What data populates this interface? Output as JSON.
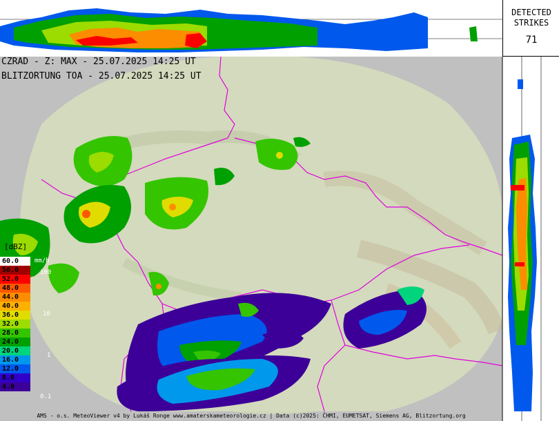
{
  "header": {
    "radar_line": "CZRAD - Z: MAX - 25.07.2025 14:25 UT",
    "lightning_line": "BLITZORTUNG TOA - 25.07.2025 14:25 UT"
  },
  "strikes": {
    "label_line1": "DETECTED",
    "label_line2": "STRIKES",
    "count": "71"
  },
  "legend": {
    "title": "[dBZ]",
    "unit": "mm/h",
    "entries": [
      {
        "label": "60.0",
        "color": "#ffffff",
        "text_color": "#000000"
      },
      {
        "label": "56.0",
        "color": "#a00000",
        "text_color": "#000000"
      },
      {
        "label": "52.0",
        "color": "#fc0000",
        "text_color": "#000000"
      },
      {
        "label": "48.0",
        "color": "#fc5800",
        "text_color": "#000000"
      },
      {
        "label": "44.0",
        "color": "#fc8c00",
        "text_color": "#000000"
      },
      {
        "label": "40.0",
        "color": "#fcb000",
        "text_color": "#000000"
      },
      {
        "label": "36.0",
        "color": "#e0dc00",
        "text_color": "#000000"
      },
      {
        "label": "32.0",
        "color": "#9cdc00",
        "text_color": "#000000"
      },
      {
        "label": "28.0",
        "color": "#34c400",
        "text_color": "#000000"
      },
      {
        "label": "24.0",
        "color": "#00a000",
        "text_color": "#000000"
      },
      {
        "label": "20.0",
        "color": "#00d47c",
        "text_color": "#000000"
      },
      {
        "label": "16.0",
        "color": "#0098ec",
        "text_color": "#000000"
      },
      {
        "label": "12.0",
        "color": "#0058ec",
        "text_color": "#000000"
      },
      {
        "label": "8.0",
        "color": "#3000c8",
        "text_color": "#000000"
      },
      {
        "label": "4.0",
        "color": "#3c0098",
        "text_color": "#000000"
      }
    ],
    "rain_marks": [
      "100",
      "10",
      "1",
      "0.1"
    ]
  },
  "footer": "AMS - o.s. MeteoViewer v4 by Lukáš Ronge www.amaterskameteorologie.cz | Data (c)2025: ČHMI, EUMETSAT, Siemens AG, Blitzortung.org"
}
